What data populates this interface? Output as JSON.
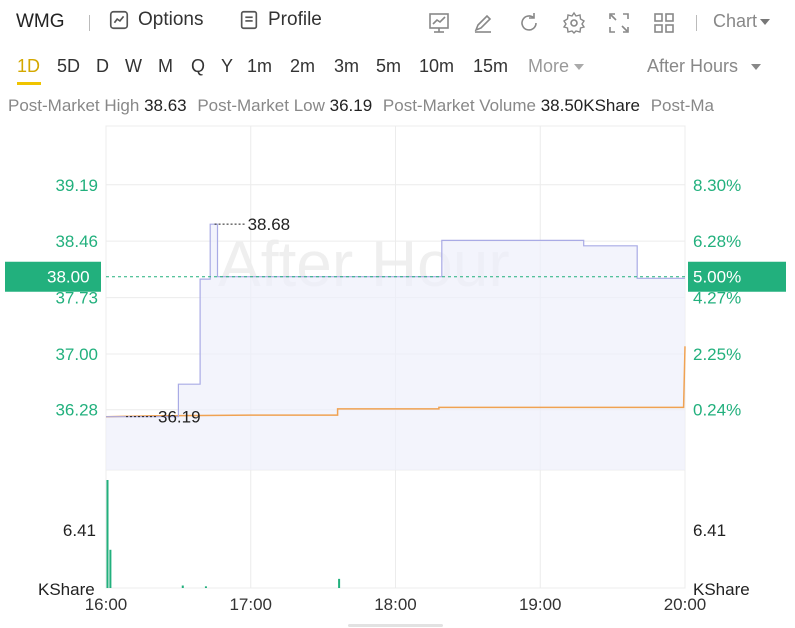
{
  "toolbar": {
    "ticker": "WMG",
    "options_label": "Options",
    "profile_label": "Profile",
    "chart_dropdown": "Chart",
    "icons": [
      "indicator-icon",
      "draw-icon",
      "refresh-icon",
      "settings-icon",
      "fullscreen-icon",
      "layout-icon"
    ]
  },
  "timeframes": [
    "1D",
    "5D",
    "D",
    "W",
    "M",
    "Q",
    "Y",
    "1m",
    "2m",
    "3m",
    "5m",
    "10m",
    "15m"
  ],
  "active_timeframe": "1D",
  "more_label": "More",
  "session_label": "After Hours",
  "stats": [
    {
      "label": "Post-Market High",
      "value": "38.63"
    },
    {
      "label": "Post-Market Low",
      "value": "36.19"
    },
    {
      "label": "Post-Market Volume",
      "value": "38.50KShare"
    },
    {
      "label": "Post-Ma",
      "value": ""
    }
  ],
  "colors": {
    "accent": "#f0c400",
    "up": "#22b07d",
    "price_line": "#a9abe5",
    "avg_line": "#f0a252",
    "grid": "#ececec"
  },
  "chart_data": {
    "type": "line",
    "watermark": "After Hour",
    "x_ticks": [
      "16:00",
      "17:00",
      "18:00",
      "19:00",
      "20:00"
    ],
    "x_range_hours": [
      16,
      20
    ],
    "y_ticks_price": [
      "39.19",
      "38.46",
      "37.73",
      "37.00",
      "36.28"
    ],
    "y_ticks_pct": [
      "8.30%",
      "6.28%",
      "4.27%",
      "2.25%",
      "0.24%"
    ],
    "ylim": [
      35.5,
      39.95
    ],
    "current_price": "38.00",
    "current_change": "5.00%",
    "high_annotation": {
      "label": "38.68",
      "time": 16.75,
      "value": 38.68
    },
    "low_annotation": {
      "label": "36.19",
      "time": 16.0,
      "value": 36.19
    },
    "series": [
      {
        "name": "price",
        "step": true,
        "points": [
          [
            16.0,
            36.19
          ],
          [
            16.5,
            36.19
          ],
          [
            16.5,
            36.61
          ],
          [
            16.65,
            36.61
          ],
          [
            16.65,
            37.97
          ],
          [
            16.72,
            37.97
          ],
          [
            16.72,
            38.68
          ],
          [
            16.77,
            38.68
          ],
          [
            16.77,
            38.0
          ],
          [
            18.32,
            38.0
          ],
          [
            18.32,
            38.47
          ],
          [
            19.3,
            38.47
          ],
          [
            19.3,
            38.4
          ],
          [
            19.67,
            38.4
          ],
          [
            19.67,
            37.98
          ],
          [
            20.0,
            37.98
          ]
        ]
      },
      {
        "name": "average",
        "step": true,
        "points": [
          [
            16.0,
            36.19
          ],
          [
            16.3,
            36.2
          ],
          [
            17.0,
            36.21
          ],
          [
            17.6,
            36.21
          ],
          [
            17.6,
            36.29
          ],
          [
            18.3,
            36.29
          ],
          [
            18.3,
            36.31
          ],
          [
            19.99,
            36.31
          ],
          [
            20.0,
            37.1
          ]
        ]
      }
    ],
    "volume": {
      "unit": "KShare",
      "tick": "6.41",
      "max": 13.0,
      "bars": [
        [
          16.0,
          13.0
        ],
        [
          16.02,
          4.6
        ],
        [
          16.52,
          0.3
        ],
        [
          16.68,
          0.2
        ],
        [
          17.6,
          1.1
        ]
      ]
    }
  }
}
